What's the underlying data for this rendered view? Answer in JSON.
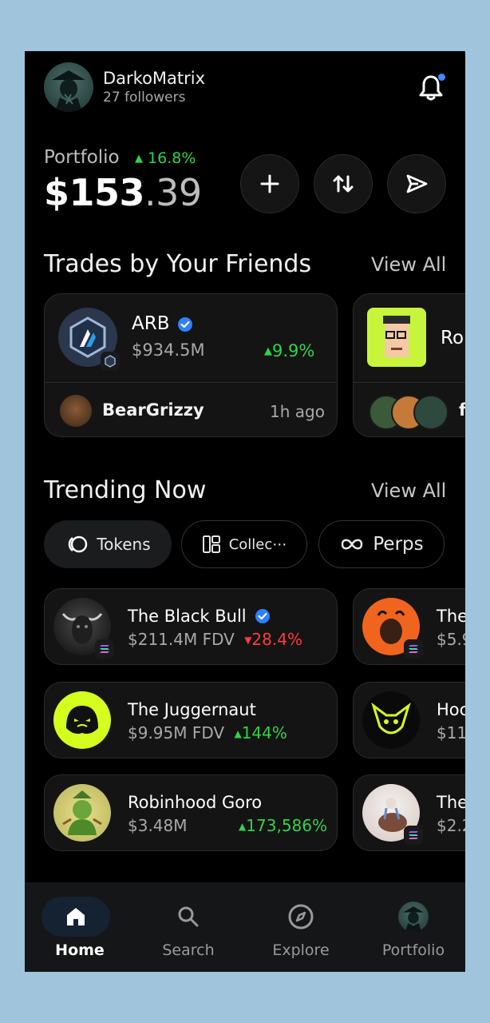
{
  "header": {
    "username": "DarkoMatrix",
    "followers": "27 followers",
    "notification_dot_color": "#3d8bff"
  },
  "portfolio": {
    "label": "Portfolio",
    "change": "16.8%",
    "value_main": "$153",
    "value_cents": ".39",
    "actions": [
      "add",
      "swap",
      "send"
    ]
  },
  "friends": {
    "title": "Trades by Your Friends",
    "view_all": "View All",
    "cards": [
      {
        "token": "ARB",
        "verified": true,
        "mcap": "$934.5M",
        "change": "9.9%",
        "trader": "BearGrizzy",
        "time": "1h ago"
      },
      {
        "token": "Ro",
        "trader_initial": "f"
      }
    ]
  },
  "trending": {
    "title": "Trending Now",
    "view_all": "View All",
    "tabs": [
      {
        "label": "Tokens",
        "icon": "tokens-icon",
        "active": true
      },
      {
        "label": "Collec⋯",
        "icon": "collections-icon",
        "active": false
      },
      {
        "label": "Perps",
        "icon": "infinity-icon",
        "active": false
      }
    ],
    "left_items": [
      {
        "name": "The Black Bull",
        "verified": true,
        "mcap": "$211.4M FDV",
        "change": "28.4%",
        "direction": "down"
      },
      {
        "name": "The Juggernaut",
        "mcap": "$9.95M FDV",
        "change": "144%",
        "direction": "up"
      },
      {
        "name": "Robinhood Goro",
        "mcap": "$3.48M",
        "change": "173,586%",
        "direction": "up"
      }
    ],
    "right_items": [
      {
        "name": "The",
        "mcap": "$5.9"
      },
      {
        "name": "Hoc",
        "mcap": "$11."
      },
      {
        "name": "The",
        "mcap": "$2.2"
      }
    ]
  },
  "nav": [
    {
      "label": "Home",
      "icon": "home-icon",
      "active": true
    },
    {
      "label": "Search",
      "icon": "search-icon",
      "active": false
    },
    {
      "label": "Explore",
      "icon": "compass-icon",
      "active": false
    },
    {
      "label": "Portfolio",
      "icon": "portfolio-avatar-icon",
      "active": false
    }
  ],
  "colors": {
    "up": "#2fd34a",
    "down": "#ff3b3b",
    "accent": "#3d8bff"
  }
}
